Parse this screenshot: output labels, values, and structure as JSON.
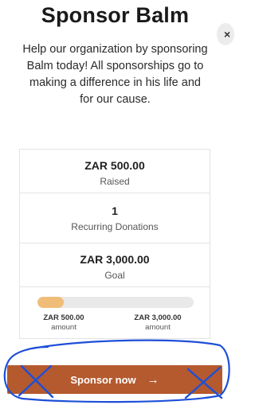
{
  "header": {
    "title": "Sponsor Balm",
    "close_icon": "×"
  },
  "description": "Help our organization by sponsoring Balm today! All sponsorships go to making a difference in his life and for our cause.",
  "stats": {
    "raised": {
      "value": "ZAR 500.00",
      "label": "Raised"
    },
    "recurring": {
      "value": "1",
      "label": "Recurring Donations"
    },
    "goal": {
      "value": "ZAR 3,000.00",
      "label": "Goal"
    }
  },
  "progress": {
    "fraction": 0.1667,
    "fill_color": "#f0bd78",
    "raised_amount": "ZAR 500.00",
    "raised_caption": "amount",
    "goal_amount": "ZAR 3,000.00",
    "goal_caption": "amount"
  },
  "cta": {
    "label": "Sponsor now",
    "arrow": "→",
    "color": "#b45a2e"
  },
  "annotation_color": "#1e4fd8"
}
